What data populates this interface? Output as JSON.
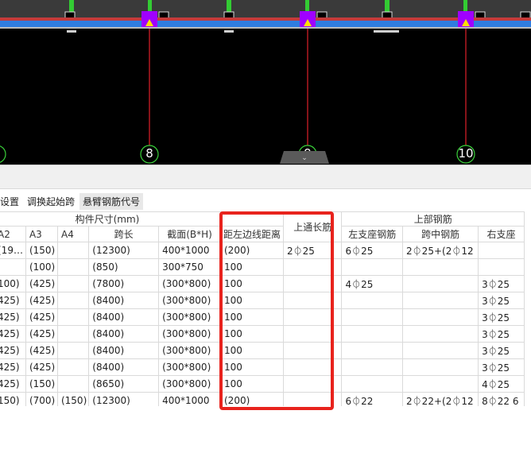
{
  "cad": {
    "axis_labels": [
      "8",
      "9",
      "10"
    ],
    "beam_marks": [
      "",
      "",
      "",
      ""
    ],
    "colors": {
      "beam": "#2f7de0",
      "column": "#a000ff",
      "axis": "#e0202a",
      "stirrup": "#33cc33",
      "background": "#000000"
    }
  },
  "toolbar": {
    "items": [
      "设置",
      "调换起始跨",
      "悬臂钢筋代号"
    ]
  },
  "grid": {
    "group_headers": {
      "size": "构件尺寸(mm)",
      "top_through": "上通长筋",
      "top_rebar": "上部钢筋"
    },
    "columns": [
      "A2",
      "A3",
      "A4",
      "跨长",
      "截面(B*H)",
      "距左边线距离",
      "左支座钢筋",
      "跨中钢筋",
      "右支座"
    ],
    "rows": [
      [
        "(19…",
        "(150)",
        "",
        "(12300)",
        "400*1000",
        "(200)",
        "2⏀25",
        "6⏀25",
        "2⏀25+(2⏀12",
        ""
      ],
      [
        "",
        "(100)",
        "",
        "(850)",
        "300*750",
        "100",
        "",
        "",
        "",
        ""
      ],
      [
        "100)",
        "(425)",
        "",
        "(7800)",
        "(300*800)",
        "100",
        "",
        "4⏀25",
        "",
        "3⏀25"
      ],
      [
        "425)",
        "(425)",
        "",
        "(8400)",
        "(300*800)",
        "100",
        "",
        "",
        "",
        "3⏀25"
      ],
      [
        "425)",
        "(425)",
        "",
        "(8400)",
        "(300*800)",
        "100",
        "",
        "",
        "",
        "3⏀25"
      ],
      [
        "425)",
        "(425)",
        "",
        "(8400)",
        "(300*800)",
        "100",
        "",
        "",
        "",
        "3⏀25"
      ],
      [
        "425)",
        "(425)",
        "",
        "(8400)",
        "(300*800)",
        "100",
        "",
        "",
        "",
        "3⏀25"
      ],
      [
        "425)",
        "(425)",
        "",
        "(8400)",
        "(300*800)",
        "100",
        "",
        "",
        "",
        "3⏀25"
      ],
      [
        "425)",
        "(150)",
        "",
        "(8650)",
        "(300*800)",
        "100",
        "",
        "",
        "",
        "4⏀25"
      ],
      [
        "150)",
        "(700)",
        "(150)",
        "(12300)",
        "400*1000",
        "(200)",
        "",
        "6⏀22",
        "2⏀22+(2⏀12",
        "8⏀22 6"
      ]
    ]
  },
  "highlight_color": "#e8231d"
}
